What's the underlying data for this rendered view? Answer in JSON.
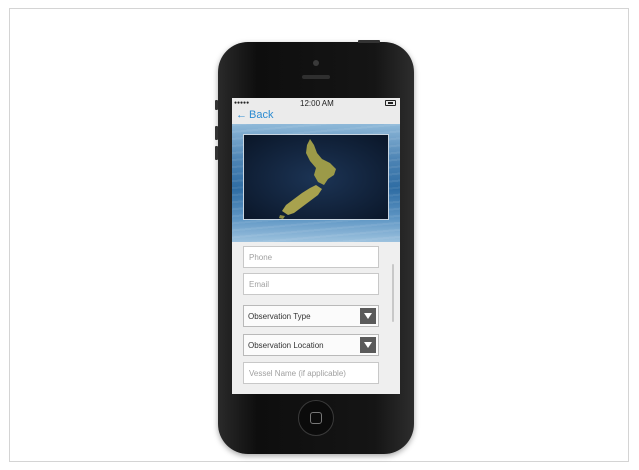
{
  "status_bar": {
    "signal": "●●●●●",
    "time": "12:00 AM"
  },
  "nav": {
    "back_arrow": "←",
    "back_label": "Back"
  },
  "hero": {
    "image": "map-of-new-zealand",
    "colors": {
      "land": "#a8a24e",
      "sea": "#0f1f35",
      "ocean_backdrop": "#2e6ca3"
    }
  },
  "form": {
    "phone_placeholder": "Phone",
    "email_placeholder": "Email",
    "observation_type": "Observation Type",
    "observation_location": "Observation Location",
    "vessel_placeholder": "Vessel Name (if applicable)"
  },
  "icons": {
    "dropdown": "dropdown-arrow-icon",
    "battery": "battery-icon",
    "home": "home-button"
  }
}
